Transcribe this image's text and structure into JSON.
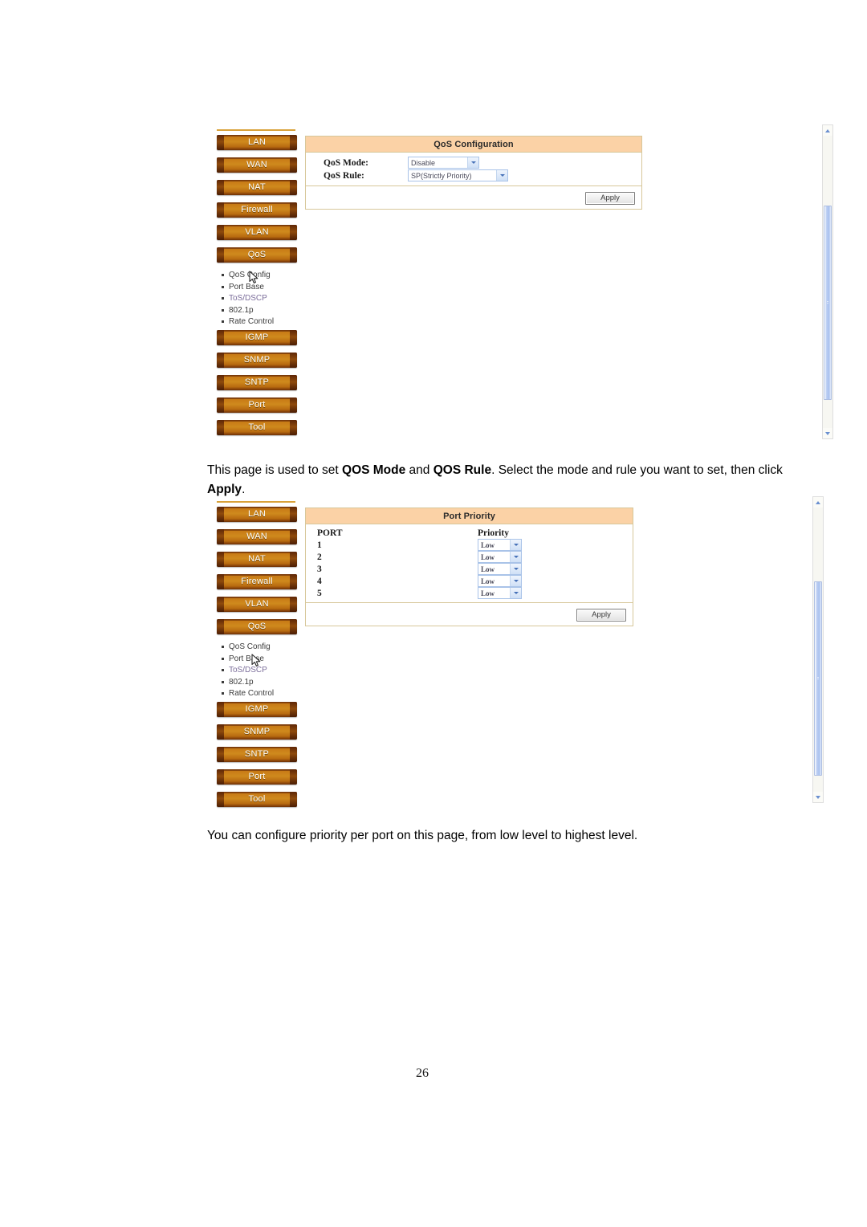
{
  "document": {
    "page_number": "26"
  },
  "paragraphs": {
    "qos_config_desc": {
      "part1": "This page is used to set ",
      "bold1": "QOS Mode",
      "part2": " and ",
      "bold2": "QOS Rule",
      "part3": ". Select the mode and rule you want to set, then click ",
      "bold3": "Apply",
      "part4": "."
    },
    "port_priority_desc": {
      "text": "You can configure priority per port on this page, from low level to highest level."
    }
  },
  "screenshot_qos_config": {
    "sidebar": {
      "buttons_top": [
        {
          "label": "LAN"
        },
        {
          "label": "WAN"
        },
        {
          "label": "NAT"
        },
        {
          "label": "Firewall"
        },
        {
          "label": "VLAN"
        },
        {
          "label": "QoS"
        }
      ],
      "submenu": [
        {
          "label": "QoS Config",
          "style": "normal"
        },
        {
          "label": "Port Base",
          "style": "normal"
        },
        {
          "label": "ToS/DSCP",
          "style": "lilac"
        },
        {
          "label": "802.1p",
          "style": "normal"
        },
        {
          "label": "Rate Control",
          "style": "normal"
        }
      ],
      "buttons_bottom": [
        {
          "label": "IGMP"
        },
        {
          "label": "SNMP"
        },
        {
          "label": "SNTP"
        },
        {
          "label": "Port"
        },
        {
          "label": "Tool"
        }
      ],
      "cursor_over": "QoS Config"
    },
    "panel": {
      "title": "QoS Configuration",
      "fields": [
        {
          "label": "QoS Mode:",
          "value": "Disable"
        },
        {
          "label": "QoS Rule:",
          "value": "SP(Strictly Priority)"
        }
      ],
      "apply_label": "Apply"
    }
  },
  "screenshot_port_priority": {
    "sidebar": {
      "buttons_top": [
        {
          "label": "LAN"
        },
        {
          "label": "WAN"
        },
        {
          "label": "NAT"
        },
        {
          "label": "Firewall"
        },
        {
          "label": "VLAN"
        },
        {
          "label": "QoS"
        }
      ],
      "submenu": [
        {
          "label": "QoS Config",
          "style": "normal"
        },
        {
          "label": "Port Base",
          "style": "normal"
        },
        {
          "label": "ToS/DSCP",
          "style": "lilac"
        },
        {
          "label": "802.1p",
          "style": "normal"
        },
        {
          "label": "Rate Control",
          "style": "normal"
        }
      ],
      "buttons_bottom": [
        {
          "label": "IGMP"
        },
        {
          "label": "SNMP"
        },
        {
          "label": "SNTP"
        },
        {
          "label": "Port"
        },
        {
          "label": "Tool"
        }
      ],
      "cursor_over": "Port Base"
    },
    "panel": {
      "title": "Port Priority",
      "columns": [
        "PORT",
        "Priority"
      ],
      "rows": [
        {
          "port": "1",
          "priority": "Low"
        },
        {
          "port": "2",
          "priority": "Low"
        },
        {
          "port": "3",
          "priority": "Low"
        },
        {
          "port": "4",
          "priority": "Low"
        },
        {
          "port": "5",
          "priority": "Low"
        }
      ],
      "apply_label": "Apply"
    }
  },
  "colors": {
    "panel_header_bg": "#fbd2a6",
    "panel_border": "#d7c79a",
    "nav_button_orange": "#cf8a1d",
    "nav_button_dark": "#5d2606",
    "select_border": "#a9c3e8",
    "scrollbar_thumb": "#aac2ef"
  }
}
